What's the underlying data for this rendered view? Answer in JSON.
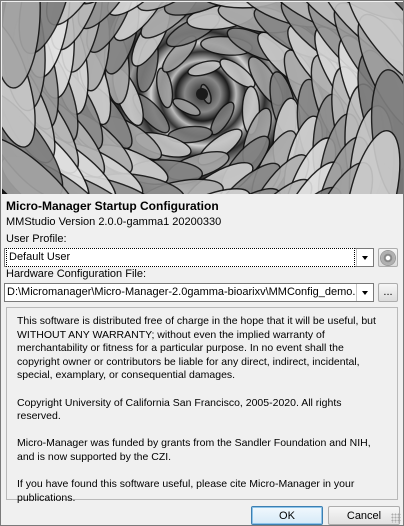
{
  "app": {
    "title": "Micro-Manager Startup Configuration",
    "version": "MMStudio Version 2.0.0-gamma1 20200330"
  },
  "splash": {
    "icon": "succulent-spiral-image"
  },
  "user_profile": {
    "label": "User Profile:",
    "value": "Default User",
    "settings_icon": "gear-icon"
  },
  "hardware_config": {
    "label": "Hardware Configuration File:",
    "value": "D:\\Micromanager\\Micro-Manager-2.0gamma-bioarixv\\MMConfig_demo...",
    "browse_label": "..."
  },
  "license": {
    "paragraphs": [
      "This software is distributed free of charge in the hope that it will be useful, but WITHOUT ANY WARRANTY; without even the implied warranty of merchantability or fitness for a particular purpose. In no event shall the copyright owner or contributors be liable for any direct, indirect, incidental, special, examplary, or consequential damages.",
      "Copyright University of California San Francisco, 2005-2020. All rights reserved.",
      "Micro-Manager was funded by grants from the Sandler Foundation and NIH, and is now supported by the CZI.",
      "If you have found this software useful, please cite Micro-Manager in your publications."
    ]
  },
  "buttons": {
    "ok": "OK",
    "cancel": "Cancel"
  }
}
